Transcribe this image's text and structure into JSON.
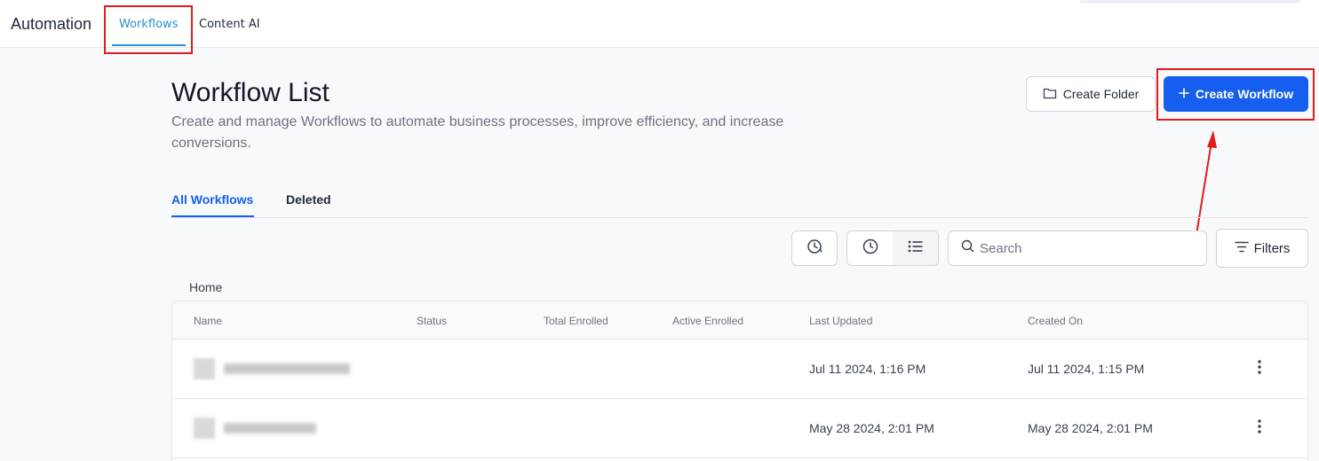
{
  "topbar": {
    "app_title": "Automation",
    "tabs": [
      {
        "label": "Workflows",
        "active": true
      },
      {
        "label": "Content AI",
        "active": false
      }
    ]
  },
  "header": {
    "title": "Workflow List",
    "subtitle": "Create and manage Workflows to automate business processes, improve efficiency, and increase conversions.",
    "create_folder_label": "Create Folder",
    "create_workflow_label": "Create Workflow"
  },
  "sub_tabs": [
    {
      "label": "All Workflows",
      "active": true
    },
    {
      "label": "Deleted",
      "active": false
    }
  ],
  "toolbar": {
    "search_placeholder": "Search",
    "filters_label": "Filters"
  },
  "breadcrumb": "Home",
  "table": {
    "columns": [
      "Name",
      "Status",
      "Total Enrolled",
      "Active Enrolled",
      "Last Updated",
      "Created On"
    ],
    "rows": [
      {
        "last_updated": "Jul 11 2024, 1:16 PM",
        "created_on": "Jul 11 2024, 1:15 PM"
      },
      {
        "last_updated": "May 28 2024, 2:01 PM",
        "created_on": "May 28 2024, 2:01 PM"
      }
    ]
  },
  "colors": {
    "accent_blue": "#155eef",
    "tab_blue": "#2b8fd6",
    "highlight_red": "#e01b1b"
  },
  "icons": [
    "folder-icon",
    "plus-icon",
    "clock-history-icon",
    "clock-icon",
    "list-icon",
    "search-icon",
    "filter-icon",
    "kebab-icon"
  ]
}
